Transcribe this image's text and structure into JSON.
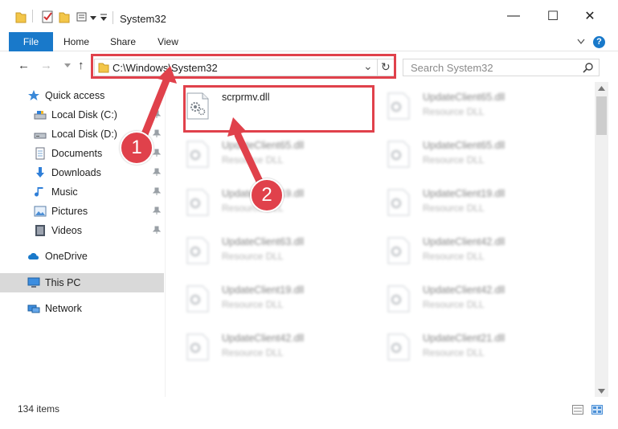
{
  "window": {
    "title": "System32",
    "minimize": "—",
    "maximize": "☐",
    "close": "✕"
  },
  "ribbon": {
    "tabs": [
      "File",
      "Home",
      "Share",
      "View"
    ],
    "help": "?"
  },
  "nav": {
    "back": "←",
    "forward": "→",
    "up": "↑",
    "address": "C:\\Windows\\System32",
    "dropdown": "⌄",
    "refresh": "↻",
    "search_placeholder": "Search System32",
    "search_icon": "⌕"
  },
  "sidebar": {
    "items": [
      {
        "label": "Quick access",
        "icon": "star-icon"
      },
      {
        "label": "Local Disk (C:)",
        "icon": "drive-icon",
        "pinned": true
      },
      {
        "label": "Local Disk (D:)",
        "icon": "drive-icon",
        "pinned": true
      },
      {
        "label": "Documents",
        "icon": "documents-icon",
        "pinned": true
      },
      {
        "label": "Downloads",
        "icon": "downloads-icon",
        "pinned": true
      },
      {
        "label": "Music",
        "icon": "music-icon",
        "pinned": true
      },
      {
        "label": "Pictures",
        "icon": "pictures-icon",
        "pinned": true
      },
      {
        "label": "Videos",
        "icon": "videos-icon",
        "pinned": true
      },
      {
        "label": "OneDrive",
        "icon": "onedrive-icon"
      },
      {
        "label": "This PC",
        "icon": "pc-icon",
        "selected": true
      },
      {
        "label": "Network",
        "icon": "network-icon"
      }
    ]
  },
  "files": {
    "items": [
      {
        "name": "scrprmv.dll",
        "type": ""
      },
      {
        "name": "UpdateClient65.dll",
        "type": "Resource DLL"
      },
      {
        "name": "UpdateClient65.dll",
        "type": "Resource DLL"
      },
      {
        "name": "UpdateClient65.dll",
        "type": "Resource DLL"
      },
      {
        "name": "UpdateClient19.dll",
        "type": "Resource DLL"
      },
      {
        "name": "UpdateClient19.dll",
        "type": "Resource DLL"
      },
      {
        "name": "UpdateClient63.dll",
        "type": "Resource DLL"
      },
      {
        "name": "UpdateClient42.dll",
        "type": "Resource DLL"
      },
      {
        "name": "UpdateClient19.dll",
        "type": "Resource DLL"
      },
      {
        "name": "UpdateClient42.dll",
        "type": "Resource DLL"
      },
      {
        "name": "UpdateClient42.dll",
        "type": "Resource DLL"
      },
      {
        "name": "UpdateClient21.dll",
        "type": "Resource DLL"
      }
    ]
  },
  "status": {
    "count": "134 items"
  },
  "annotations": {
    "badge1": "1",
    "badge2": "2"
  },
  "colors": {
    "accent": "#1979ca",
    "highlight": "#e0414b",
    "selected": "#d9d9d9"
  }
}
